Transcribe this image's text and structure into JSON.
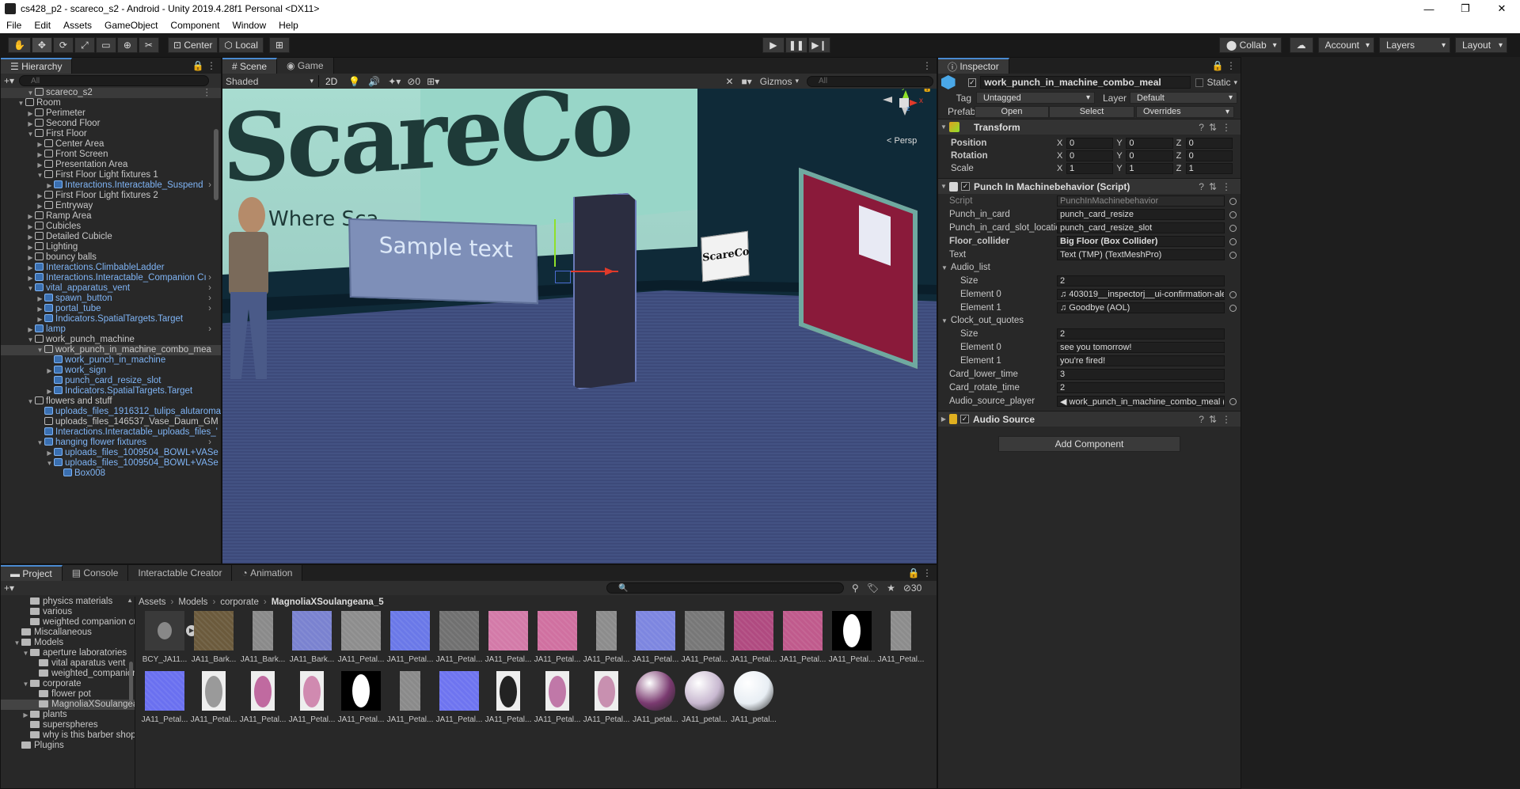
{
  "window": {
    "title": "cs428_p2 - scareco_s2 - Android - Unity 2019.4.28f1 Personal <DX11>",
    "minimize": "—",
    "maximize": "❐",
    "close": "✕"
  },
  "menu": [
    "File",
    "Edit",
    "Assets",
    "GameObject",
    "Component",
    "Window",
    "Help"
  ],
  "toolbar": {
    "center": "Center",
    "local": "Local",
    "collab": "Collab",
    "account": "Account",
    "layers": "Layers",
    "layout": "Layout"
  },
  "hierarchy": {
    "tab": "Hierarchy",
    "search_placeholder": "All",
    "scene_name": "scareco_s2",
    "rows": [
      {
        "label": "Room",
        "indent": 1,
        "arrow": "▼",
        "blue": false
      },
      {
        "label": "Perimeter",
        "indent": 2,
        "arrow": "▶",
        "blue": false
      },
      {
        "label": "Second Floor",
        "indent": 2,
        "arrow": "▶",
        "blue": false
      },
      {
        "label": "First Floor",
        "indent": 2,
        "arrow": "▼",
        "blue": false
      },
      {
        "label": "Center Area",
        "indent": 3,
        "arrow": "▶",
        "blue": false
      },
      {
        "label": "Front Screen",
        "indent": 3,
        "arrow": "▶",
        "blue": false
      },
      {
        "label": "Presentation Area",
        "indent": 3,
        "arrow": "▶",
        "blue": false
      },
      {
        "label": "First Floor Light fixtures 1",
        "indent": 3,
        "arrow": "▼",
        "blue": false
      },
      {
        "label": "Interactions.Interactable_Suspend",
        "indent": 4,
        "arrow": "▶",
        "blue": true,
        "more": true
      },
      {
        "label": "First Floor Light fixtures 2",
        "indent": 3,
        "arrow": "▶",
        "blue": false
      },
      {
        "label": "Entryway",
        "indent": 3,
        "arrow": "▶",
        "blue": false
      },
      {
        "label": "Ramp Area",
        "indent": 2,
        "arrow": "▶",
        "blue": false
      },
      {
        "label": "Cubicles",
        "indent": 2,
        "arrow": "▶",
        "blue": false
      },
      {
        "label": "Detailed Cubicle",
        "indent": 2,
        "arrow": "▶",
        "blue": false
      },
      {
        "label": "Lighting",
        "indent": 2,
        "arrow": "▶",
        "blue": false
      },
      {
        "label": "bouncy balls",
        "indent": 2,
        "arrow": "▶",
        "blue": false
      },
      {
        "label": "Interactions.ClimbableLadder",
        "indent": 2,
        "arrow": "▶",
        "blue": true
      },
      {
        "label": "Interactions.Interactable_Companion Cı",
        "indent": 2,
        "arrow": "▶",
        "blue": true,
        "more": true
      },
      {
        "label": "vital_apparatus_vent",
        "indent": 2,
        "arrow": "▼",
        "blue": true,
        "more": true
      },
      {
        "label": "spawn_button",
        "indent": 3,
        "arrow": "▶",
        "blue": true,
        "more": true
      },
      {
        "label": "portal_tube",
        "indent": 3,
        "arrow": "▶",
        "blue": true,
        "more": true
      },
      {
        "label": "Indicators.SpatialTargets.Target",
        "indent": 3,
        "arrow": "▶",
        "blue": true
      },
      {
        "label": "lamp",
        "indent": 2,
        "arrow": "▶",
        "blue": true,
        "more": true
      },
      {
        "label": "work_punch_machine",
        "indent": 2,
        "arrow": "▼",
        "blue": false
      },
      {
        "label": "work_punch_in_machine_combo_mea",
        "indent": 3,
        "arrow": "▼",
        "blue": false,
        "sel": true,
        "more": true
      },
      {
        "label": "work_punch_in_machine",
        "indent": 4,
        "arrow": "",
        "blue": true
      },
      {
        "label": "work_sign",
        "indent": 4,
        "arrow": "▶",
        "blue": true
      },
      {
        "label": "punch_card_resize_slot",
        "indent": 4,
        "arrow": "",
        "blue": true
      },
      {
        "label": "Indicators.SpatialTargets.Target",
        "indent": 4,
        "arrow": "▶",
        "blue": true
      },
      {
        "label": "flowers and stuff",
        "indent": 2,
        "arrow": "▼",
        "blue": false
      },
      {
        "label": "uploads_files_1916312_tulips_alutaroma",
        "indent": 3,
        "arrow": "",
        "blue": true
      },
      {
        "label": "uploads_files_146537_Vase_Daum_GM",
        "indent": 3,
        "arrow": "",
        "blue": false
      },
      {
        "label": "Interactions.Interactable_uploads_files_'",
        "indent": 3,
        "arrow": "",
        "blue": true
      },
      {
        "label": "hanging flower fixtures",
        "indent": 3,
        "arrow": "▼",
        "blue": true,
        "more": true
      },
      {
        "label": "uploads_files_1009504_BOWL+VASe",
        "indent": 4,
        "arrow": "▶",
        "blue": true
      },
      {
        "label": "uploads_files_1009504_BOWL+VASe",
        "indent": 4,
        "arrow": "▼",
        "blue": true
      },
      {
        "label": "Box008",
        "indent": 5,
        "arrow": "",
        "blue": true
      }
    ]
  },
  "scene": {
    "tab_scene": "Scene",
    "tab_game": "Game",
    "shading": "Shaded",
    "mode_2d": "2D",
    "fx_count": "0",
    "gizmos": "Gizmos",
    "search_placeholder": "All",
    "persp": "< Persp",
    "sign_text": "Sample text",
    "logo_text": "ScareCo",
    "logo_sub": "Where Sca",
    "axis_x": "x",
    "axis_y": "y",
    "axis_z": "z"
  },
  "inspector": {
    "tab": "Inspector",
    "object_name": "work_punch_in_machine_combo_meal",
    "static_label": "Static",
    "tag_label": "Tag",
    "tag_value": "Untagged",
    "layer_label": "Layer",
    "layer_value": "Default",
    "prefab_label": "Prefab",
    "prefab_open": "Open",
    "prefab_select": "Select",
    "prefab_overrides": "Overrides",
    "transform": {
      "title": "Transform",
      "rows": [
        {
          "label": "Position",
          "x": "0",
          "y": "0",
          "z": "0"
        },
        {
          "label": "Rotation",
          "x": "0",
          "y": "0",
          "z": "0"
        },
        {
          "label": "Scale",
          "x": "1",
          "y": "1",
          "z": "1"
        }
      ]
    },
    "script": {
      "title": "Punch In Machinebehavior (Script)",
      "fields": [
        {
          "label": "Script",
          "value": "PunchInMachinebehavior",
          "dim": true,
          "indent": 0
        },
        {
          "label": "Punch_in_card",
          "value": "punch_card_resize",
          "indent": 0
        },
        {
          "label": "Punch_in_card_slot_location",
          "value": "punch_card_resize_slot",
          "indent": 0
        },
        {
          "label": "Floor_collider",
          "value": "Big Floor (Box Collider)",
          "bold": true,
          "indent": 0
        },
        {
          "label": "Text",
          "value": "Text (TMP) (TextMeshPro)",
          "indent": 0
        },
        {
          "label": "Audio_list",
          "value": "",
          "header": true,
          "indent": 0
        },
        {
          "label": "Size",
          "value": "2",
          "indent": 1,
          "noring": true
        },
        {
          "label": "Element 0",
          "value": "♫ 403019__inspectorj__ui-confirmation-alert-",
          "indent": 1
        },
        {
          "label": "Element 1",
          "value": "♫ Goodbye (AOL)",
          "indent": 1
        },
        {
          "label": "Clock_out_quotes",
          "value": "",
          "header": true,
          "indent": 0
        },
        {
          "label": "Size",
          "value": "2",
          "indent": 1,
          "noring": true
        },
        {
          "label": "Element 0",
          "value": "see you tomorrow!",
          "indent": 1,
          "noring": true
        },
        {
          "label": "Element 1",
          "value": "you're fired!",
          "indent": 1,
          "noring": true
        },
        {
          "label": "Card_lower_time",
          "value": "3",
          "indent": 0,
          "noring": true
        },
        {
          "label": "Card_rotate_time",
          "value": "2",
          "indent": 0,
          "noring": true
        },
        {
          "label": "Audio_source_player",
          "value": "◀ work_punch_in_machine_combo_meal (Aud",
          "indent": 0
        }
      ]
    },
    "audio_source": "Audio Source",
    "add_component": "Add Component"
  },
  "project": {
    "tabs": [
      "Project",
      "Console",
      "Interactable Creator",
      "Animation"
    ],
    "hidden_count": "30",
    "breadcrumb": [
      "Assets",
      "Models",
      "corporate",
      "MagnoliaXSoulangeana_5"
    ],
    "tree": [
      {
        "label": "physics materials",
        "indent": 2,
        "arrow": ""
      },
      {
        "label": "various",
        "indent": 2,
        "arrow": ""
      },
      {
        "label": "weighted companion cu",
        "indent": 2,
        "arrow": ""
      },
      {
        "label": "Miscallaneous",
        "indent": 1,
        "arrow": ""
      },
      {
        "label": "Models",
        "indent": 1,
        "arrow": "▼"
      },
      {
        "label": "aperture laboratories",
        "indent": 2,
        "arrow": "▼"
      },
      {
        "label": "vital aparatus vent",
        "indent": 3,
        "arrow": ""
      },
      {
        "label": "weighted_companior",
        "indent": 3,
        "arrow": ""
      },
      {
        "label": "corporate",
        "indent": 2,
        "arrow": "▼"
      },
      {
        "label": "flower pot",
        "indent": 3,
        "arrow": ""
      },
      {
        "label": "MagnoliaXSoulangea",
        "indent": 3,
        "arrow": "",
        "sel": true
      },
      {
        "label": "plants",
        "indent": 2,
        "arrow": "▶"
      },
      {
        "label": "superspheres",
        "indent": 2,
        "arrow": ""
      },
      {
        "label": "why is this barber shop",
        "indent": 2,
        "arrow": ""
      },
      {
        "label": "Plugins",
        "indent": 1,
        "arrow": ""
      }
    ],
    "assets": [
      {
        "label": "BCY_JA11...",
        "color": "#3a3a3a",
        "kind": "model"
      },
      {
        "label": "JA11_Bark...",
        "color": "#6b5a3c"
      },
      {
        "label": "JA11_Bark...",
        "color": "#8a8a8a"
      },
      {
        "label": "JA11_Bark...",
        "color": "#7a82d0"
      },
      {
        "label": "JA11_Petal...",
        "color": "#8d8d8d"
      },
      {
        "label": "JA11_Petal...",
        "color": "#6a78e8"
      },
      {
        "label": "JA11_Petal...",
        "color": "#707070"
      },
      {
        "label": "JA11_Petal...",
        "color": "#d37aa8"
      },
      {
        "label": "JA11_Petal...",
        "color": "#d070a0"
      },
      {
        "label": "JA11_Petal...",
        "color": "#8c8c8c"
      },
      {
        "label": "JA11_Petal...",
        "color": "#7d86e0"
      },
      {
        "label": "JA11_Petal...",
        "color": "#777777"
      },
      {
        "label": "JA11_Petal...",
        "color": "#b04a80"
      },
      {
        "label": "JA11_Petal...",
        "color": "#c05a8c"
      },
      {
        "label": "JA11_Petal...",
        "color": "#000000",
        "kind": "mask"
      },
      {
        "label": "JA11_Petal...",
        "color": "#8c8c8c"
      },
      {
        "label": "JA11_Petal...",
        "color": "#6a70f0"
      },
      {
        "label": "JA11_Petal...",
        "color": "#9a9a9a",
        "kind": "petal"
      },
      {
        "label": "JA11_Petal...",
        "color": "#c06aa0",
        "kind": "petal"
      },
      {
        "label": "JA11_Petal...",
        "color": "#d08ab0",
        "kind": "petal"
      },
      {
        "label": "JA11_Petal...",
        "color": "#000000",
        "kind": "mask"
      },
      {
        "label": "JA11_Petal...",
        "color": "#8a8a8a"
      },
      {
        "label": "JA11_Petal...",
        "color": "#6e74f0"
      },
      {
        "label": "JA11_Petal...",
        "color": "#222222",
        "kind": "petal"
      },
      {
        "label": "JA11_Petal...",
        "color": "#c078a8",
        "kind": "petal"
      },
      {
        "label": "JA11_Petal...",
        "color": "#c890b0",
        "kind": "petal"
      },
      {
        "label": "JA11_petal...",
        "color": "#7a3a70",
        "kind": "sphere"
      },
      {
        "label": "JA11_petal...",
        "color": "#c8b8d0",
        "kind": "sphere"
      },
      {
        "label": "JA11_petal...",
        "color": "#e8eef4",
        "kind": "sphere"
      }
    ]
  }
}
